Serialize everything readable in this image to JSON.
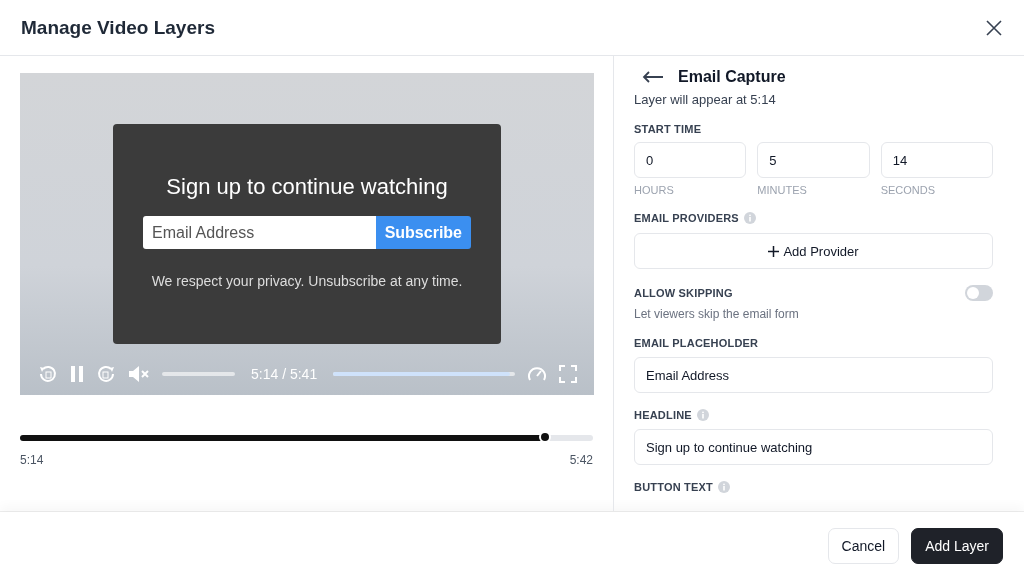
{
  "dialog": {
    "title": "Manage Video Layers"
  },
  "player": {
    "overlay": {
      "headline": "Sign up to continue watching",
      "email_placeholder": "Email Address",
      "button": "Subscribe",
      "note": "We respect your privacy. Unsubscribe at any time."
    },
    "controls": {
      "time": "5:14 / 5:41",
      "muted": true,
      "volume": {
        "level": 0
      },
      "playing": true,
      "progress": {
        "level": 0.97
      }
    }
  },
  "timeline": {
    "level": 0.916,
    "start": "5:14",
    "end": "5:42"
  },
  "panel": {
    "title": "Email Capture",
    "subtitle": "Layer will appear at 5:14",
    "start_time": {
      "label": "START TIME",
      "fields": [
        {
          "value": "0",
          "caption": "HOURS"
        },
        {
          "value": "5",
          "caption": "MINUTES"
        },
        {
          "value": "14",
          "caption": "SECONDS"
        }
      ]
    },
    "email_providers": {
      "label": "EMAIL PROVIDERS",
      "button": "Add Provider"
    },
    "allow_skipping": {
      "label": "ALLOW SKIPPING",
      "description": "Let viewers skip the email form",
      "on": false
    },
    "email_placeholder": {
      "label": "EMAIL PLACEHOLDER",
      "value": "Email Address"
    },
    "headline": {
      "label": "HEADLINE",
      "value": "Sign up to continue watching"
    },
    "button_text": {
      "label": "BUTTON TEXT"
    }
  },
  "buttons": [
    {
      "label": "Cancel",
      "kind": "secondary"
    },
    {
      "label": "Add Layer",
      "kind": "primary"
    }
  ]
}
